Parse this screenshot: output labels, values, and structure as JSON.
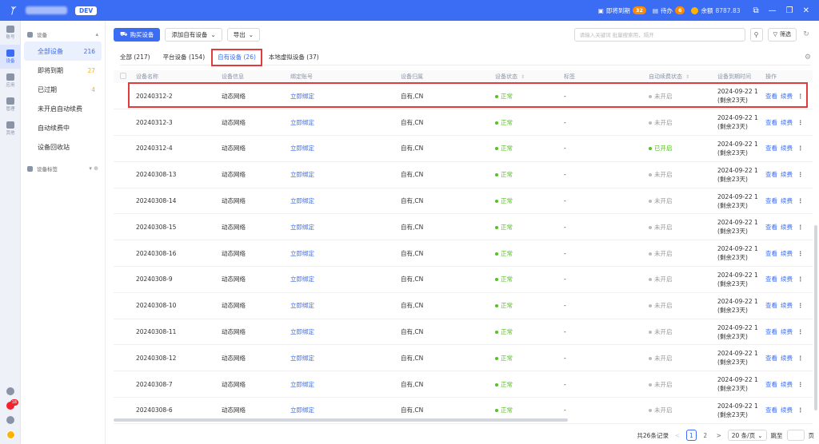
{
  "topbar": {
    "dev_badge": "DEV",
    "notice_expiring_label": "即将到期",
    "notice_expiring_count": "32",
    "notice_todo_label": "待办",
    "notice_todo_count": "6",
    "balance_label": "余额",
    "balance_value": "8787.83",
    "win_min": "—",
    "win_max": "❐",
    "win_close": "✕"
  },
  "rail": {
    "items": [
      {
        "label": "账号",
        "icon": "account-icon"
      },
      {
        "label": "设备",
        "icon": "device-icon"
      },
      {
        "label": "应用",
        "icon": "cloud-icon"
      },
      {
        "label": "管理",
        "icon": "manage-icon"
      },
      {
        "label": "其他",
        "icon": "other-icon"
      }
    ],
    "bottom_badge": "18"
  },
  "sidebar": {
    "group_label": "设备",
    "items": [
      {
        "label": "全部设备",
        "count": "216"
      },
      {
        "label": "即将到期",
        "count": "27"
      },
      {
        "label": "已过期",
        "count": "4"
      },
      {
        "label": "未开启自动续费",
        "count": ""
      },
      {
        "label": "自动续费中",
        "count": ""
      },
      {
        "label": "设备回收站",
        "count": ""
      }
    ],
    "group2_label": "设备标签"
  },
  "toolbar": {
    "buy_label": "购买设备",
    "add_label": "添加自有设备",
    "export_label": "导出",
    "search_placeholder": "请输入关键词 批量搜索用，隔开",
    "filter_label": "筛选"
  },
  "tabs": [
    {
      "label": "全部 (217)"
    },
    {
      "label": "平台设备 (154)"
    },
    {
      "label": "自有设备 (26)"
    },
    {
      "label": "本地虚拟设备 (37)"
    }
  ],
  "table": {
    "headers": [
      "设备名称",
      "设备信息",
      "绑定账号",
      "设备归属",
      "设备状态",
      "标签",
      "自动续费状态",
      "设备到期时间",
      "操作"
    ],
    "rows": [
      {
        "name": "20240312-2",
        "info": "动态网络",
        "bind": "立即绑定",
        "owner": "自有,CN",
        "status": "正常",
        "tag": "-",
        "auto": "未开启",
        "auto_on": false,
        "exp": "2024-09-22 1",
        "exp_left": "(剩余23天)"
      },
      {
        "name": "20240312-3",
        "info": "动态网络",
        "bind": "立即绑定",
        "owner": "自有,CN",
        "status": "正常",
        "tag": "-",
        "auto": "未开启",
        "auto_on": false,
        "exp": "2024-09-22 1",
        "exp_left": "(剩余23天)"
      },
      {
        "name": "20240312-4",
        "info": "动态网络",
        "bind": "立即绑定",
        "owner": "自有,CN",
        "status": "正常",
        "tag": "-",
        "auto": "已开启",
        "auto_on": true,
        "exp": "2024-09-22 1",
        "exp_left": "(剩余23天)"
      },
      {
        "name": "20240308-13",
        "info": "动态网络",
        "bind": "立即绑定",
        "owner": "自有,CN",
        "status": "正常",
        "tag": "-",
        "auto": "未开启",
        "auto_on": false,
        "exp": "2024-09-22 1",
        "exp_left": "(剩余23天)"
      },
      {
        "name": "20240308-14",
        "info": "动态网络",
        "bind": "立即绑定",
        "owner": "自有,CN",
        "status": "正常",
        "tag": "-",
        "auto": "未开启",
        "auto_on": false,
        "exp": "2024-09-22 1",
        "exp_left": "(剩余23天)"
      },
      {
        "name": "20240308-15",
        "info": "动态网络",
        "bind": "立即绑定",
        "owner": "自有,CN",
        "status": "正常",
        "tag": "-",
        "auto": "未开启",
        "auto_on": false,
        "exp": "2024-09-22 1",
        "exp_left": "(剩余23天)"
      },
      {
        "name": "20240308-16",
        "info": "动态网络",
        "bind": "立即绑定",
        "owner": "自有,CN",
        "status": "正常",
        "tag": "-",
        "auto": "未开启",
        "auto_on": false,
        "exp": "2024-09-22 1",
        "exp_left": "(剩余23天)"
      },
      {
        "name": "20240308-9",
        "info": "动态网络",
        "bind": "立即绑定",
        "owner": "自有,CN",
        "status": "正常",
        "tag": "-",
        "auto": "未开启",
        "auto_on": false,
        "exp": "2024-09-22 1",
        "exp_left": "(剩余23天)"
      },
      {
        "name": "20240308-10",
        "info": "动态网络",
        "bind": "立即绑定",
        "owner": "自有,CN",
        "status": "正常",
        "tag": "-",
        "auto": "未开启",
        "auto_on": false,
        "exp": "2024-09-22 1",
        "exp_left": "(剩余23天)"
      },
      {
        "name": "20240308-11",
        "info": "动态网络",
        "bind": "立即绑定",
        "owner": "自有,CN",
        "status": "正常",
        "tag": "-",
        "auto": "未开启",
        "auto_on": false,
        "exp": "2024-09-22 1",
        "exp_left": "(剩余23天)"
      },
      {
        "name": "20240308-12",
        "info": "动态网络",
        "bind": "立即绑定",
        "owner": "自有,CN",
        "status": "正常",
        "tag": "-",
        "auto": "未开启",
        "auto_on": false,
        "exp": "2024-09-22 1",
        "exp_left": "(剩余23天)"
      },
      {
        "name": "20240308-7",
        "info": "动态网络",
        "bind": "立即绑定",
        "owner": "自有,CN",
        "status": "正常",
        "tag": "-",
        "auto": "未开启",
        "auto_on": false,
        "exp": "2024-09-22 1",
        "exp_left": "(剩余23天)"
      },
      {
        "name": "20240308-6",
        "info": "动态网络",
        "bind": "立即绑定",
        "owner": "自有,CN",
        "status": "正常",
        "tag": "-",
        "auto": "未开启",
        "auto_on": false,
        "exp": "2024-09-22 1",
        "exp_left": "(剩余23天)"
      }
    ],
    "op_view": "查看",
    "op_renew": "续费"
  },
  "pager": {
    "total": "共26条记录",
    "prev": "<",
    "pages": [
      "1",
      "2"
    ],
    "next": ">",
    "size": "20 条/页",
    "jump_label": "跳至",
    "jump_suffix": "页"
  },
  "colors": {
    "brand": "#3a6cf4",
    "success": "#52c41a",
    "highlight": "#e23b3b",
    "warning": "#ff8a00"
  }
}
